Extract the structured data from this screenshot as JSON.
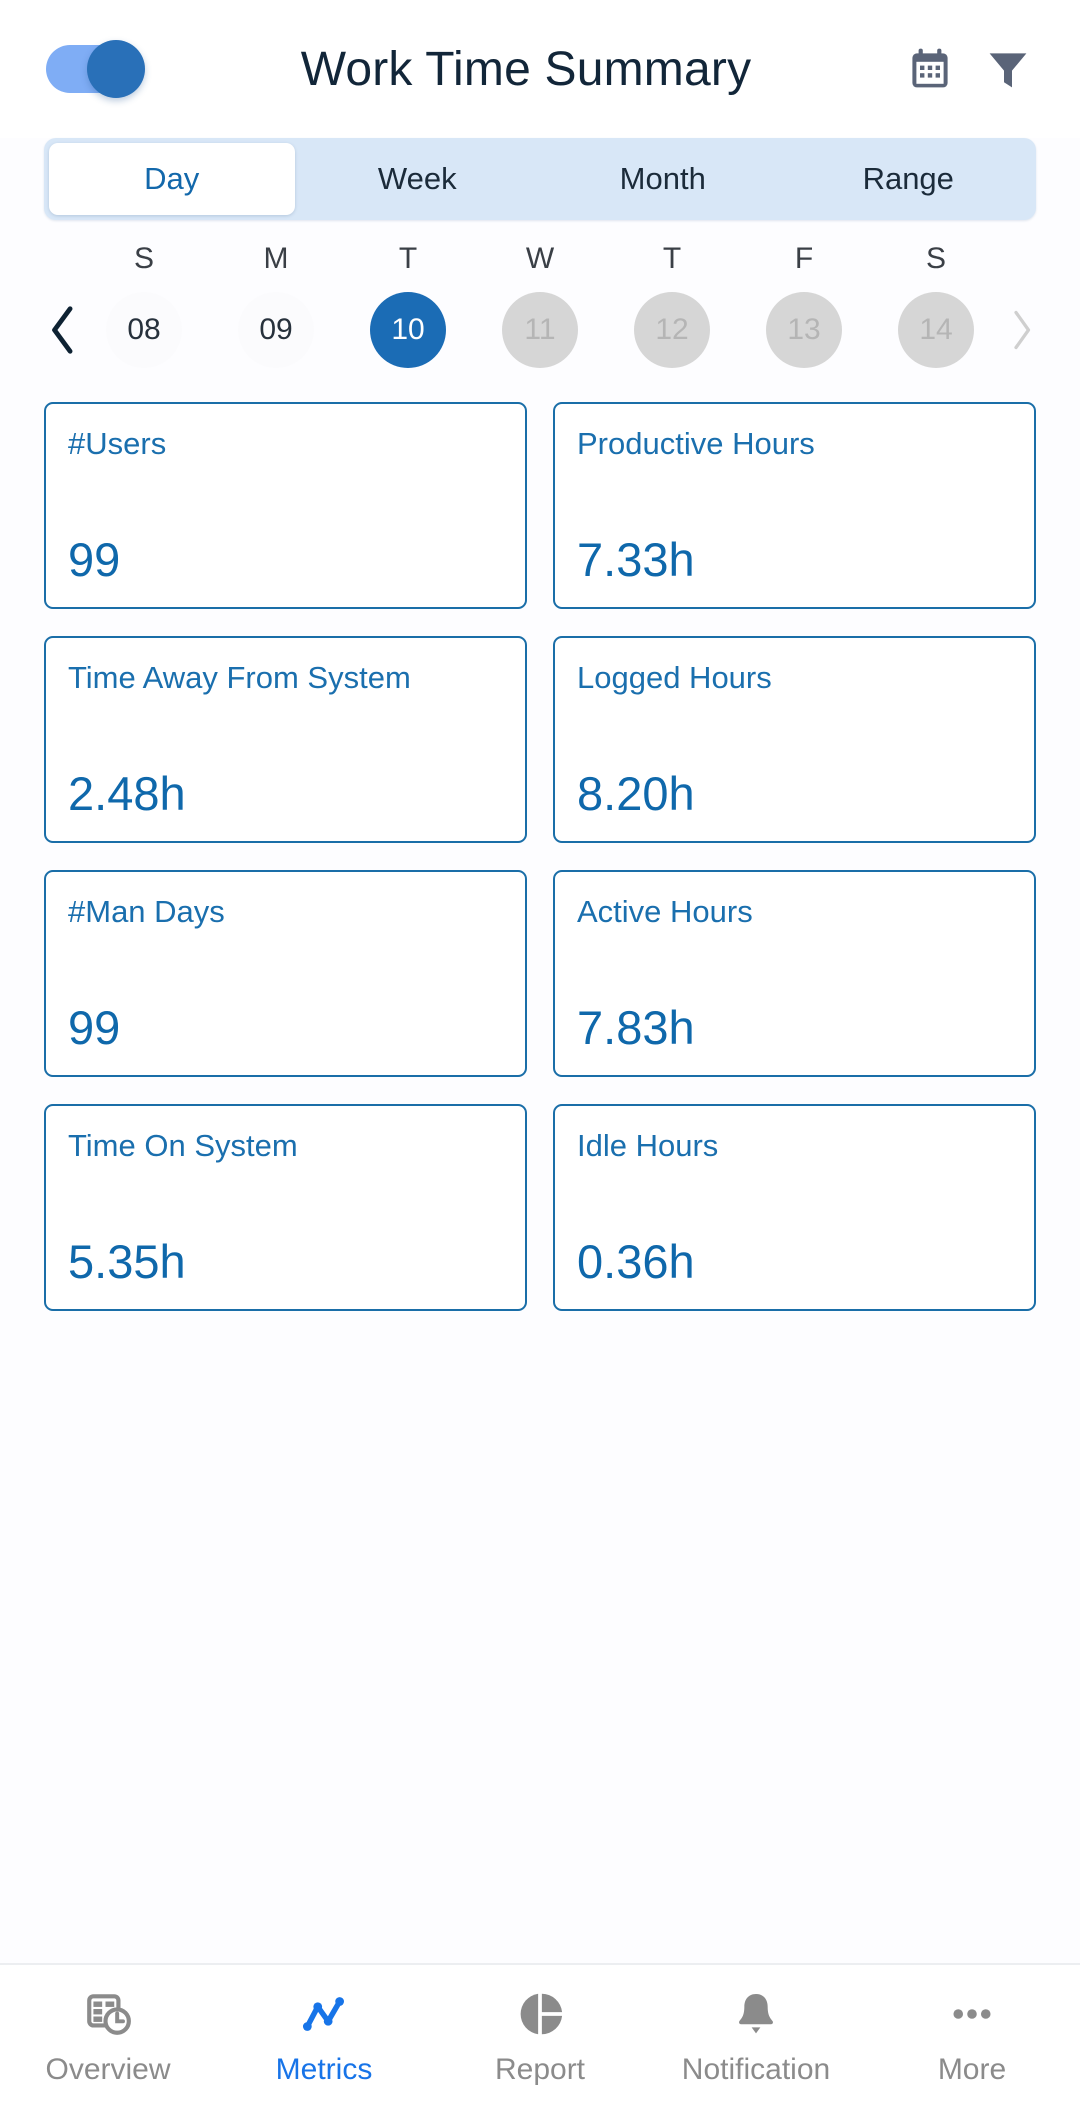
{
  "header": {
    "title": "Work Time Summary",
    "toggle": {
      "name": "view-toggle",
      "state": "on"
    },
    "calendar_icon": "calendar-icon",
    "filter_icon": "filter-icon"
  },
  "tabs": {
    "items": [
      {
        "label": "Day",
        "active": true
      },
      {
        "label": "Week",
        "active": false
      },
      {
        "label": "Month",
        "active": false
      },
      {
        "label": "Range",
        "active": false
      }
    ]
  },
  "date_strip": {
    "prev_label": "‹",
    "next_label": "›",
    "days": [
      {
        "dow": "S",
        "date": "08",
        "state": "normal"
      },
      {
        "dow": "M",
        "date": "09",
        "state": "normal"
      },
      {
        "dow": "T",
        "date": "10",
        "state": "selected"
      },
      {
        "dow": "W",
        "date": "11",
        "state": "disabled"
      },
      {
        "dow": "T",
        "date": "12",
        "state": "disabled"
      },
      {
        "dow": "F",
        "date": "13",
        "state": "disabled"
      },
      {
        "dow": "S",
        "date": "14",
        "state": "disabled"
      }
    ]
  },
  "metrics": {
    "cards": [
      {
        "label": "#Users",
        "value": "99"
      },
      {
        "label": "Productive Hours",
        "value": "7.33h"
      },
      {
        "label": "Time Away From System",
        "value": "2.48h"
      },
      {
        "label": "Logged Hours",
        "value": "8.20h"
      },
      {
        "label": "#Man Days",
        "value": "99"
      },
      {
        "label": "Active Hours",
        "value": "7.83h"
      },
      {
        "label": "Time On System",
        "value": "5.35h"
      },
      {
        "label": "Idle Hours",
        "value": "0.36h"
      }
    ]
  },
  "bottom_nav": {
    "items": [
      {
        "label": "Overview",
        "icon": "table-clock-icon",
        "active": false
      },
      {
        "label": "Metrics",
        "icon": "line-chart-icon",
        "active": true
      },
      {
        "label": "Report",
        "icon": "pie-chart-icon",
        "active": false
      },
      {
        "label": "Notification",
        "icon": "bell-icon",
        "active": false
      },
      {
        "label": "More",
        "icon": "ellipsis-icon",
        "active": false
      }
    ]
  },
  "colors": {
    "accent_blue": "#1b6cb5",
    "card_border": "#1a6ea8",
    "card_text": "#0f68ab",
    "tab_bar": "#d8e7f7",
    "nav_active": "#1774e8",
    "icon_gray": "#8b8b8b",
    "header_icon": "#5a6478"
  }
}
